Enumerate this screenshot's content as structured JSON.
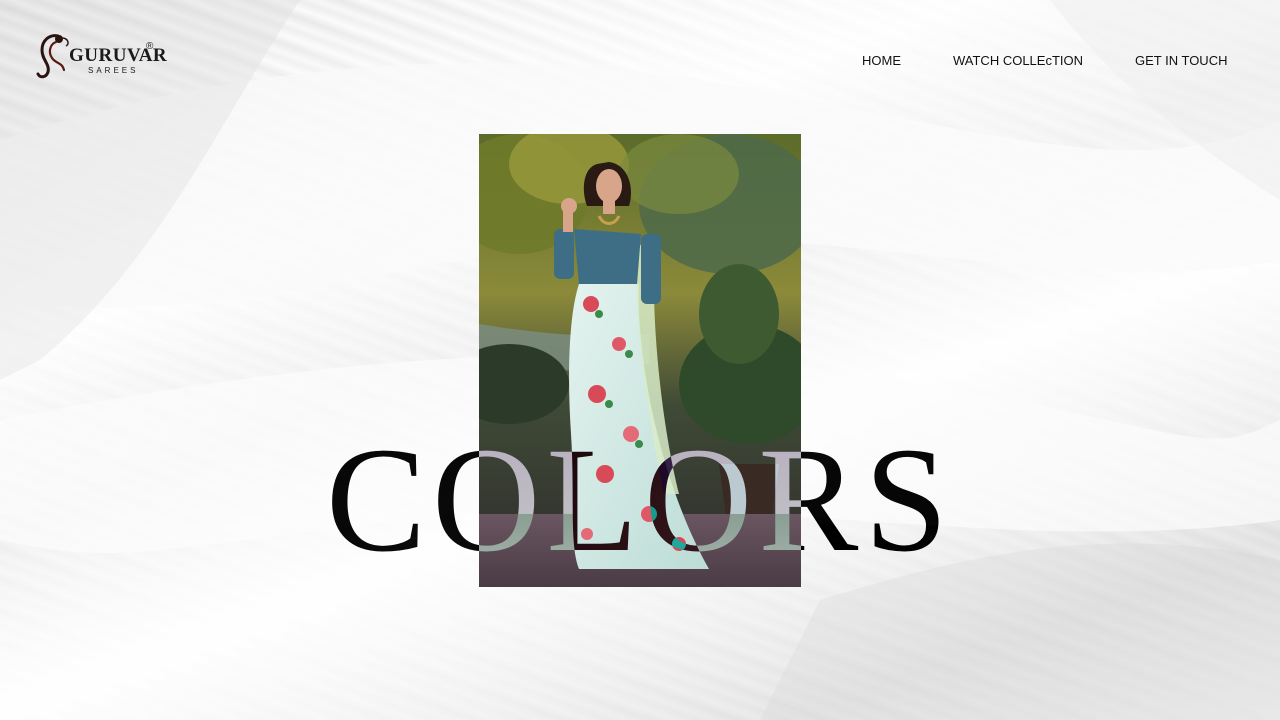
{
  "brand": {
    "name": "GURUVAR",
    "subtitle": "SAREES",
    "registered_mark": "®",
    "logo_icon": "saree-figure-logo-icon"
  },
  "nav": {
    "items": [
      {
        "label": "HOME"
      },
      {
        "label": "WATCH COLLEcTION"
      },
      {
        "label": "GET IN TOUCH"
      }
    ]
  },
  "hero": {
    "headline": "COLORS",
    "image": "model-in-floral-saree-photo"
  },
  "colors": {
    "text": "#111111",
    "background": "#ececec",
    "saree": "#cfe9e4",
    "blouse": "#3d6e86"
  }
}
